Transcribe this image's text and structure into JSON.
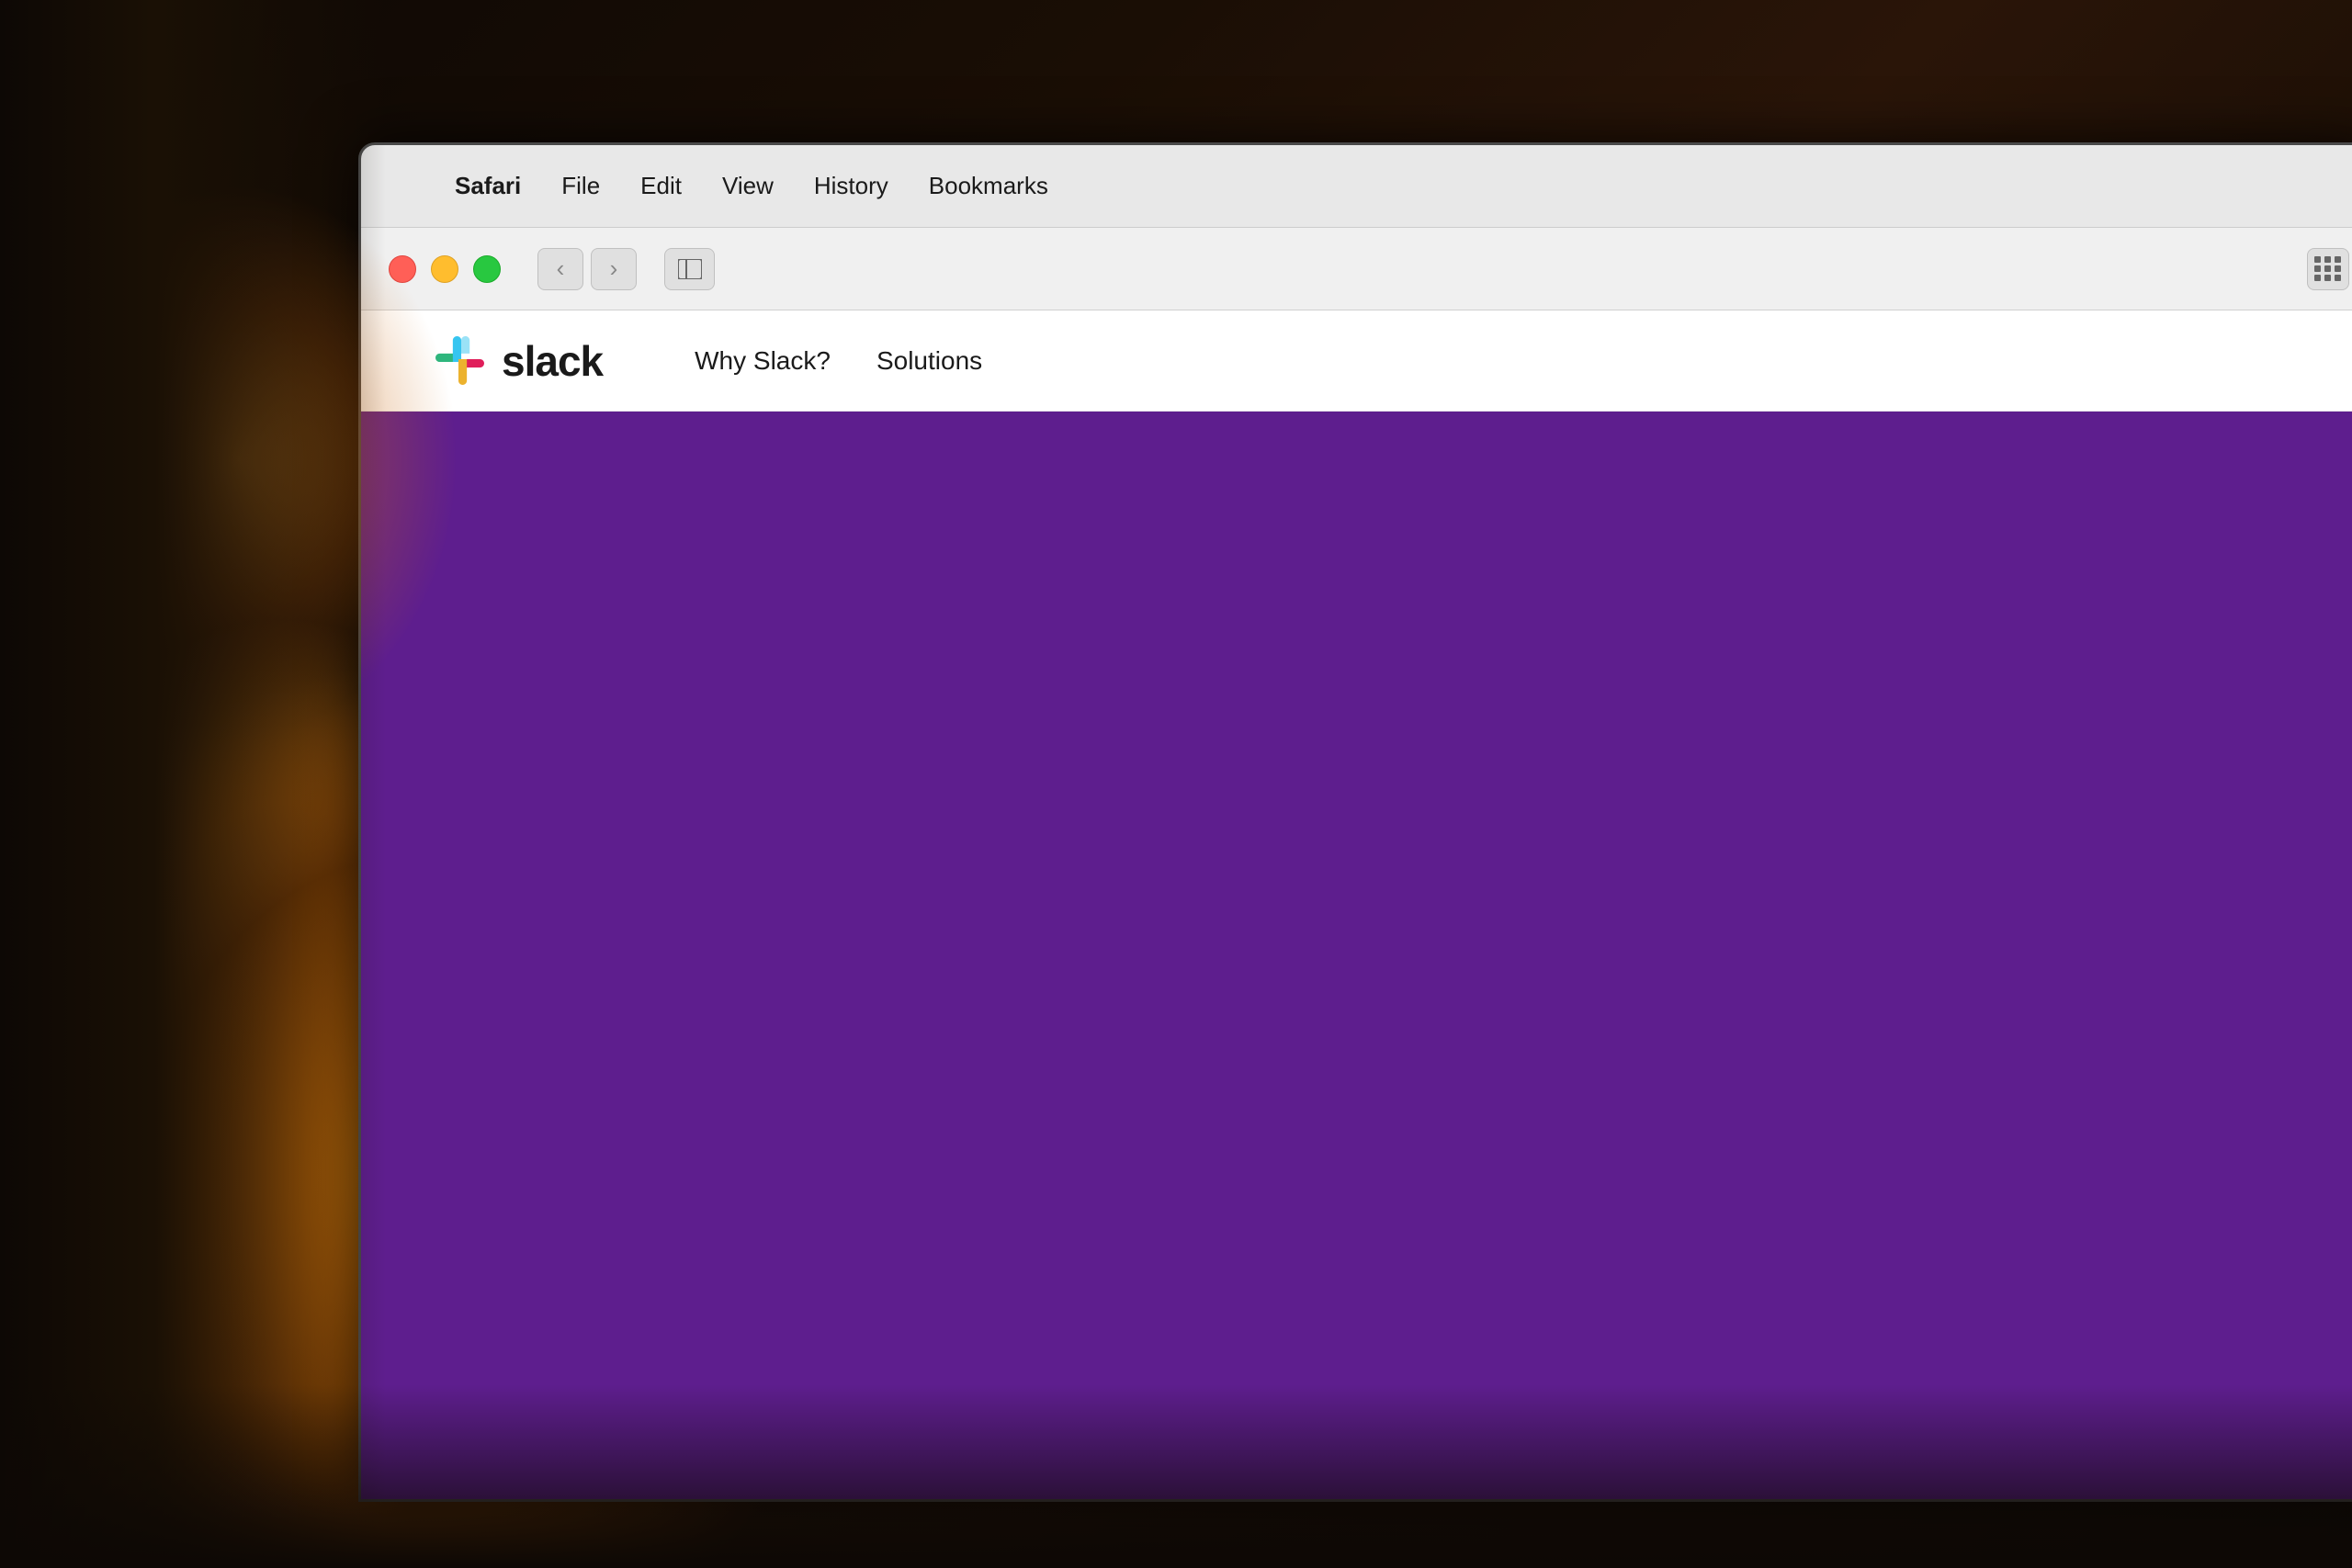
{
  "background": {
    "color": "#1a0e05"
  },
  "menubar": {
    "apple_label": "",
    "items": [
      {
        "label": "Safari",
        "bold": true
      },
      {
        "label": "File",
        "bold": false
      },
      {
        "label": "Edit",
        "bold": false
      },
      {
        "label": "View",
        "bold": false
      },
      {
        "label": "History",
        "bold": false
      },
      {
        "label": "Bookmarks",
        "bold": false
      }
    ]
  },
  "toolbar": {
    "back_label": "‹",
    "forward_label": "›",
    "sidebar_label": "⊟"
  },
  "slack": {
    "brand": "slack",
    "nav_items": [
      {
        "label": "Why Slack?"
      },
      {
        "label": "Solutions"
      }
    ],
    "hero_color": "#5e1e8e"
  }
}
